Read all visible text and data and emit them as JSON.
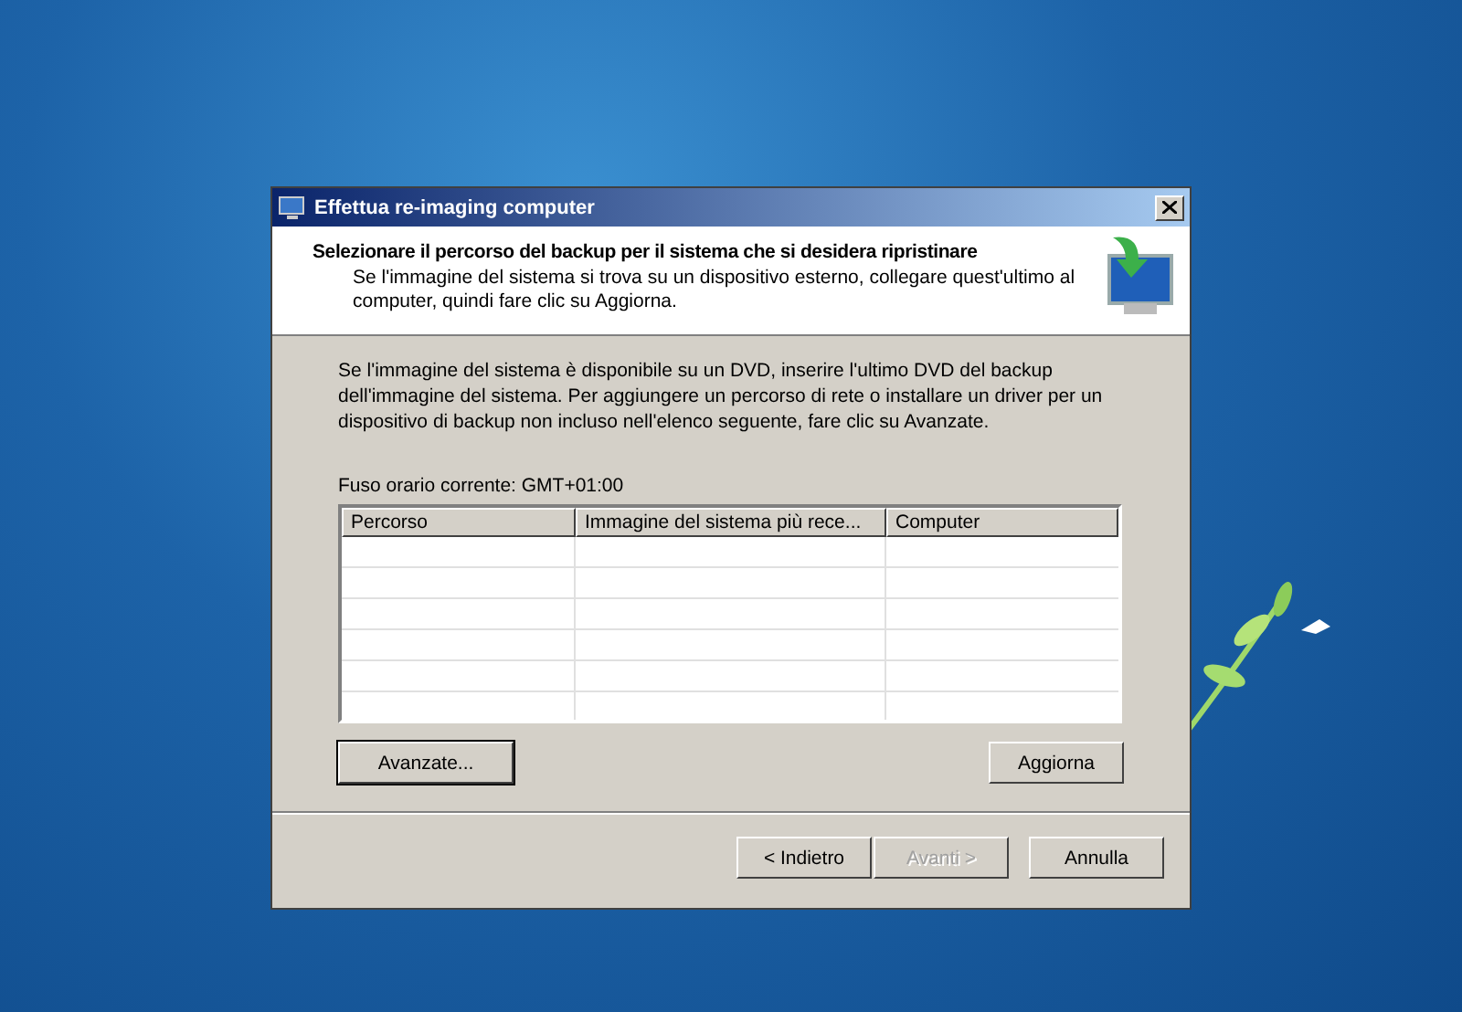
{
  "window": {
    "title": "Effettua re-imaging computer"
  },
  "header": {
    "title": "Selezionare il percorso del backup per il sistema che si desidera ripristinare",
    "subtitle": "Se l'immagine del sistema si trova su un dispositivo esterno, collegare quest'ultimo al computer, quindi fare clic su Aggiorna."
  },
  "description": "Se l'immagine del sistema è disponibile su un DVD, inserire l'ultimo DVD del backup dell'immagine del sistema. Per aggiungere un percorso di rete o installare un driver per un dispositivo di backup non incluso nell'elenco seguente, fare clic su Avanzate.",
  "timezone": "Fuso orario corrente: GMT+01:00",
  "table": {
    "columns": [
      "Percorso",
      "Immagine del sistema più rece...",
      "Computer"
    ]
  },
  "list_buttons": [
    {
      "label": "Avanzate...",
      "default": true,
      "disabled": false
    },
    {
      "label": "Aggiorna",
      "default": false,
      "disabled": false
    }
  ],
  "footer_buttons": [
    {
      "label": "< Indietro",
      "default": false,
      "disabled": false
    },
    {
      "label": "Avanti >",
      "default": false,
      "disabled": true
    },
    {
      "label": "Annulla",
      "default": false,
      "disabled": false
    }
  ]
}
